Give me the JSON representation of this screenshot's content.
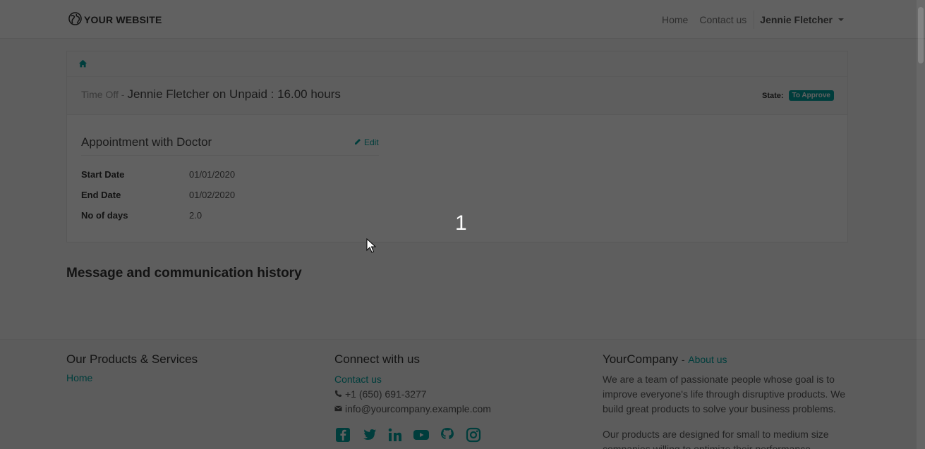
{
  "navbar": {
    "brand": "YOUR WEBSITE",
    "links": [
      "Home",
      "Contact us"
    ],
    "user": "Jennie Fletcher"
  },
  "breadcrumb": {
    "icon": "home-icon"
  },
  "header": {
    "prefix": "Time Off -",
    "title": "Jennie Fletcher on Unpaid : 16.00 hours",
    "state_label": "State:",
    "state_value": "To Approve"
  },
  "details": {
    "section_title": "Appointment with Doctor",
    "edit_label": "Edit",
    "fields": [
      {
        "label": "Start Date",
        "value": "01/01/2020"
      },
      {
        "label": "End Date",
        "value": "01/02/2020"
      },
      {
        "label": "No of days",
        "value": "2.0"
      }
    ]
  },
  "history_title": "Message and communication history",
  "footer": {
    "products": {
      "heading": "Our Products & Services",
      "link": "Home"
    },
    "connect": {
      "heading": "Connect with us",
      "contact_link": "Contact us",
      "phone": "+1 (650) 691-3277",
      "email": "info@yourcompany.example.com",
      "social_icons": [
        "facebook-icon",
        "twitter-icon",
        "linkedin-icon",
        "youtube-icon",
        "github-icon",
        "instagram-icon"
      ]
    },
    "company": {
      "name": "YourCompany",
      "separator": "-",
      "about_link": "About us",
      "text1": "We are a team of passionate people whose goal is to improve everyone's life through disruptive products. We build great products to solve your business problems.",
      "text2": "Our products are designed for small to medium size companies willing to optimize their performance."
    }
  },
  "overlay": {
    "step_number": "1"
  },
  "colors": {
    "accent": "#00a09d",
    "overlay": "rgba(0,0,0,0.62)"
  }
}
